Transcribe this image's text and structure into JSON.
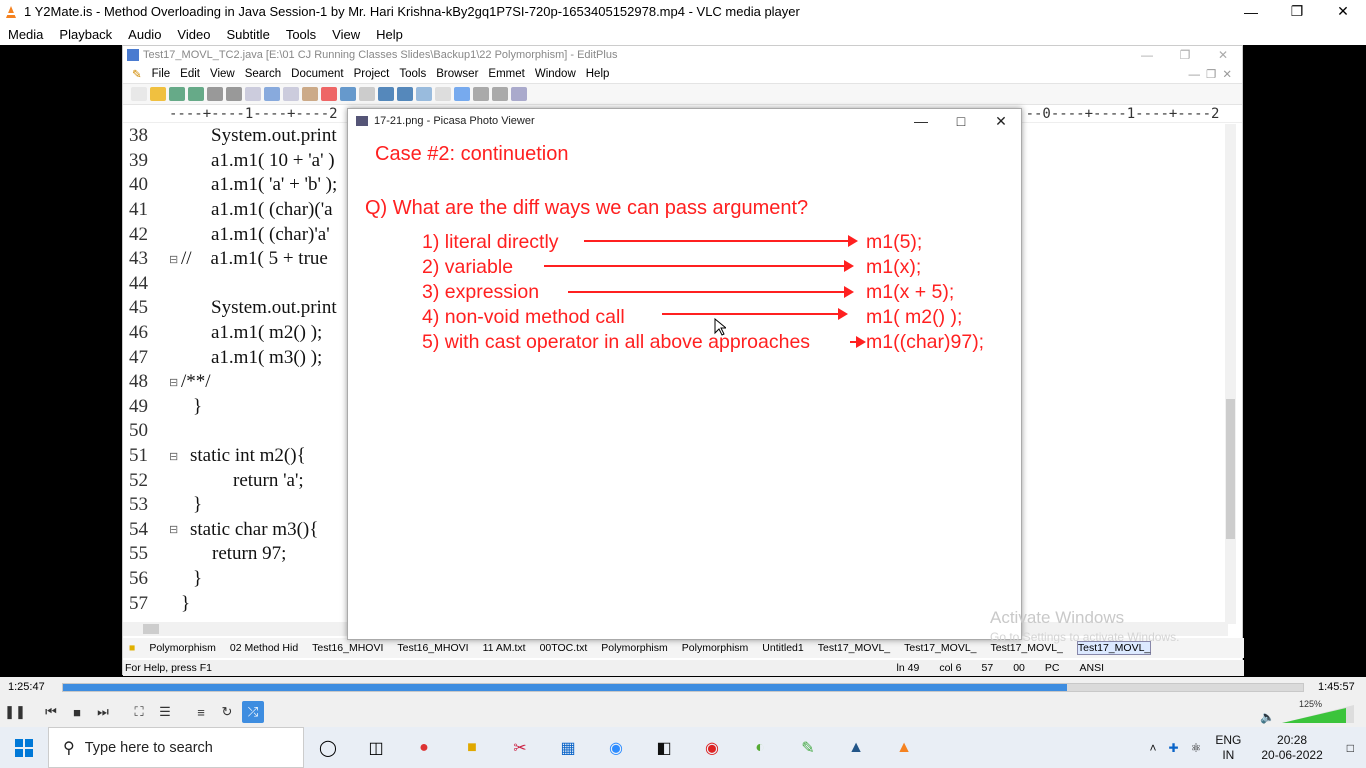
{
  "vlc": {
    "title": "1 Y2Mate.is - Method Overloading in Java  Session-1  by Mr. Hari Krishna-kBy2gq1P7SI-720p-1653405152978.mp4 - VLC media player",
    "menu": [
      "Media",
      "Playback",
      "Audio",
      "Video",
      "Subtitle",
      "Tools",
      "View",
      "Help"
    ],
    "time_elapsed": "1:25:47",
    "time_total": "1:45:57",
    "progress": 0.81,
    "volume_label": "125%"
  },
  "editplus": {
    "title": "Test17_MOVL_TC2.java [E:\\01 CJ Running Classes Slides\\Backup1\\22 Polymorphism] - EditPlus",
    "menu": [
      "File",
      "Edit",
      "View",
      "Search",
      "Document",
      "Project",
      "Tools",
      "Browser",
      "Emmet",
      "Window",
      "Help"
    ],
    "ruler_left": "----+----1----+----2",
    "ruler_right": "--0----+----1----+----2",
    "code_lines": [
      {
        "n": "38",
        "fold": "",
        "text": "System.out.print"
      },
      {
        "n": "39",
        "fold": "",
        "text": "a1.m1( 10 + 'a' )"
      },
      {
        "n": "40",
        "fold": "",
        "text": "a1.m1( 'a' + 'b' );"
      },
      {
        "n": "41",
        "fold": "",
        "text": "a1.m1( (char)('a"
      },
      {
        "n": "42",
        "fold": "",
        "text": "a1.m1( (char)'a'"
      },
      {
        "n": "43",
        "fold": "⊟",
        "text": "//    a1.m1( 5 + true"
      },
      {
        "n": "44",
        "fold": "",
        "text": ""
      },
      {
        "n": "45",
        "fold": "",
        "text": "System.out.print"
      },
      {
        "n": "46",
        "fold": "",
        "text": "a1.m1( m2() );"
      },
      {
        "n": "47",
        "fold": "",
        "text": "a1.m1( m3() );"
      },
      {
        "n": "48",
        "fold": "⊟",
        "text": "/**/"
      },
      {
        "n": "49",
        "fold": "",
        "text": "}"
      },
      {
        "n": "50",
        "fold": "",
        "text": ""
      },
      {
        "n": "51",
        "fold": "⊟",
        "text": "static int m2(){"
      },
      {
        "n": "52",
        "fold": "",
        "text": "return 'a';"
      },
      {
        "n": "53",
        "fold": "",
        "text": "}"
      },
      {
        "n": "54",
        "fold": "⊟",
        "text": "static char m3(){"
      },
      {
        "n": "55",
        "fold": "",
        "text": "return 97;"
      },
      {
        "n": "56",
        "fold": "",
        "text": "}"
      },
      {
        "n": "57",
        "fold": "",
        "text": "}"
      }
    ],
    "tabs": [
      "Polymorphism",
      "02 Method Hid",
      "Test16_MHOVI",
      "Test16_MHOVI",
      "11 AM.txt",
      "00TOC.txt",
      "Polymorphism",
      "Polymorphism",
      "Untitled1",
      "Test17_MOVL_",
      "Test17_MOVL_",
      "Test17_MOVL_",
      "Test17_MOVL_"
    ],
    "status_help": "For Help, press F1",
    "status_ln": "ln 49",
    "status_col": "col 6",
    "status_57": "57",
    "status_00": "00",
    "status_pc": "PC",
    "status_ansi": "ANSI"
  },
  "picasa": {
    "title": "17-21.png - Picasa Photo Viewer",
    "case": "Case #2: continuetion",
    "question": "Q) What are the diff ways we can pass argument?",
    "items": [
      {
        "label": "1) literal directly",
        "result": "m1(5);"
      },
      {
        "label": "2) variable",
        "result": "m1(x);"
      },
      {
        "label": "3) expression",
        "result": "m1(x + 5);"
      },
      {
        "label": "4) non-void method call",
        "result": "m1( m2() );"
      },
      {
        "label": "5) with cast operator in all above approaches",
        "result": "m1((char)97);"
      }
    ]
  },
  "watermark": {
    "line1": "Activate Windows",
    "line2": "Go to Settings to activate Windows."
  },
  "taskbar": {
    "search_placeholder": "Type here to search",
    "lang1": "ENG",
    "lang2": "IN",
    "time": "20:28",
    "date": "20-06-2022"
  }
}
